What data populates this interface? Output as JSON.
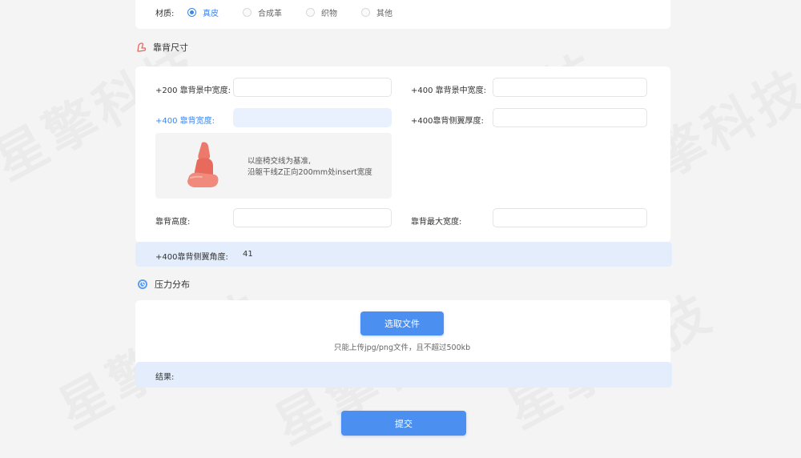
{
  "material": {
    "label": "材质:",
    "options": [
      "真皮",
      "合成革",
      "织物",
      "其他"
    ],
    "selected": "真皮"
  },
  "backrest": {
    "section_title": "靠背尺寸",
    "section_icon": "seat-icon",
    "fields": {
      "center_width_200": {
        "label": "+200 靠背景中宽度:",
        "value": ""
      },
      "center_width_400": {
        "label": "+400 靠背景中宽度:",
        "value": ""
      },
      "width_400": {
        "label": "+400 靠背宽度:",
        "value": ""
      },
      "wing_thickness_400": {
        "label": "+400靠背侧翼厚度:",
        "value": ""
      },
      "height": {
        "label": "靠背高度:",
        "value": ""
      },
      "max_width": {
        "label": "靠背最大宽度:",
        "value": ""
      }
    },
    "hint": {
      "line1": "以座椅交线为基准,",
      "line2": "沿躯干线Z正向200mm处insert宽度"
    },
    "wing_angle": {
      "label": "+400靠背侧翼角度:",
      "value": "41"
    }
  },
  "pressure": {
    "section_title": "压力分布",
    "section_icon": "pressure-icon",
    "choose_file_label": "选取文件",
    "upload_note": "只能上传jpg/png文件，且不超过500kb",
    "result_label": "结果:"
  },
  "submit_label": "提交",
  "colors": {
    "accent": "#3a86f0",
    "button": "#4b8ff0",
    "highlight_bar": "#e4edfb",
    "seat_icon": "#e8685a"
  }
}
